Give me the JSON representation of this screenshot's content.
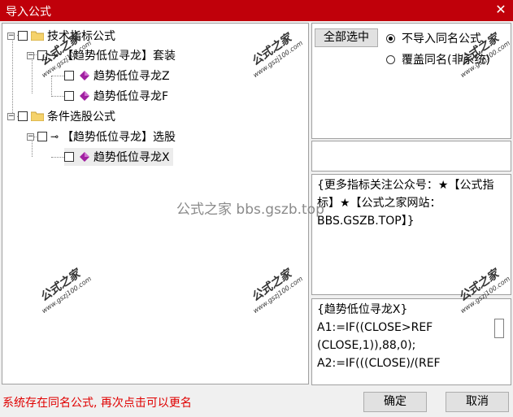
{
  "window": {
    "title": "导入公式"
  },
  "tree": {
    "groups": [
      {
        "label": "技术指标公式",
        "subgroup": {
          "label": "【趋势低位寻龙】套装",
          "items": [
            "趋势低位寻龙Z",
            "趋势低位寻龙F"
          ]
        }
      },
      {
        "label": "条件选股公式",
        "subgroup": {
          "label": "【趋势低位寻龙】选股",
          "items": [
            "趋势低位寻龙X"
          ]
        }
      }
    ]
  },
  "options": {
    "select_all": "全部选中",
    "radio_skip": "不导入同名公式",
    "radio_overwrite": "覆盖同名(非系统)",
    "selected": "skip"
  },
  "info_text": "{更多指标关注公众号：★【公式指标】★【公式之家网站：BBS.GSZB.TOP】}",
  "formula_lines": [
    "{趋势低位寻龙X}",
    "A1:=IF((CLOSE>REF",
    "(CLOSE,1)),88,0);",
    "A2:=IF(((CLOSE)/(REF"
  ],
  "status_text": "系统存在同名公式, 再次点击可以更名",
  "buttons": {
    "ok": "确定",
    "cancel": "取消"
  },
  "watermark": {
    "title": "公式之家",
    "url": "www.gszj100.com",
    "center": "公式之家 bbs.gszb.top"
  },
  "colors": {
    "titlebar": "#c0000a",
    "status": "#e00000"
  }
}
